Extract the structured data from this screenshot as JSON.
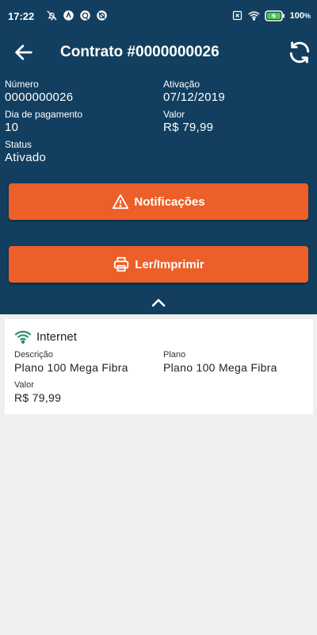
{
  "status_bar": {
    "time": "17:22",
    "battery_percent": "100",
    "percent_sign": "%",
    "icons_left": [
      "notifications-off-icon",
      "app-notification-icon",
      "sync-icon",
      "vpn-icon"
    ],
    "icons_right": [
      "no-sim-icon",
      "wifi-icon",
      "battery-charging-icon"
    ]
  },
  "app_bar": {
    "title": "Contrato #0000000026",
    "back_icon": "arrow-left-icon",
    "refresh_icon": "refresh-icon"
  },
  "contract": {
    "numero_label": "Número",
    "numero_value": "0000000026",
    "ativacao_label": "Ativação",
    "ativacao_value": "07/12/2019",
    "dia_label": "Dia de pagamento",
    "dia_value": "10",
    "valor_label": "Valor",
    "valor_value": "R$ 79,99",
    "status_label": "Status",
    "status_value": "Ativado"
  },
  "buttons": {
    "notificacoes_label": "Notificações",
    "notificacoes_icon": "warning-icon",
    "imprimir_label": "Ler/Imprimir",
    "imprimir_icon": "printer-icon",
    "collapse_icon": "chevron-up-icon"
  },
  "service_card": {
    "title": "Internet",
    "icon": "wifi-icon",
    "descricao_label": "Descrição",
    "descricao_value": "Plano 100 Mega Fibra",
    "plano_label": "Plano",
    "plano_value": "Plano 100 Mega Fibra",
    "valor_label": "Valor",
    "valor_value": "R$ 79,99"
  },
  "colors": {
    "header_bg": "#123f5f",
    "accent": "#ed5f28",
    "wifi_green": "#2e8b74",
    "page_bg": "#efefef"
  }
}
